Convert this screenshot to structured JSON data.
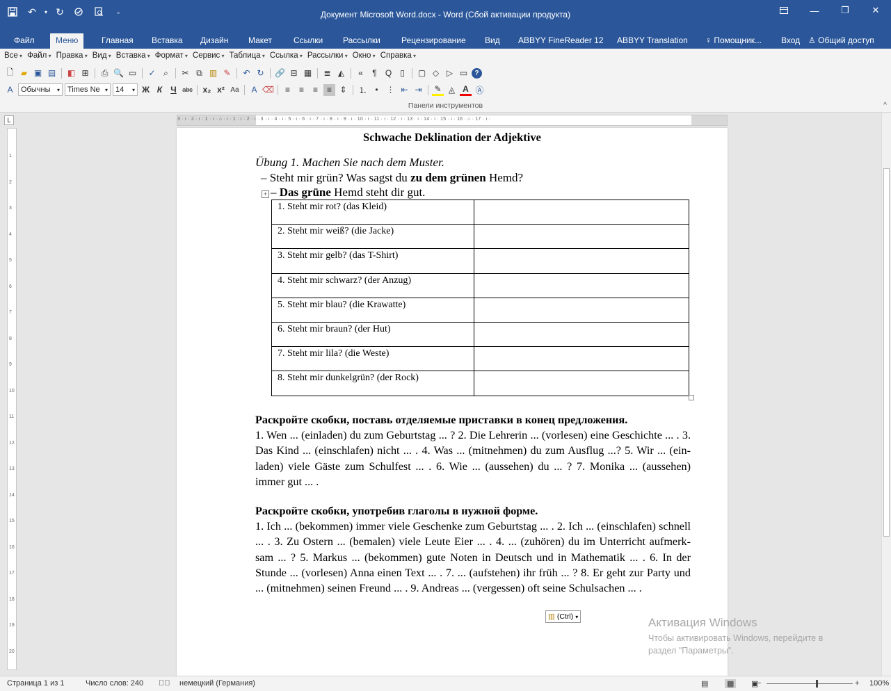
{
  "window": {
    "title": "Документ Microsoft Word.docx - Word (Сбой активации продукта)"
  },
  "qat": {
    "icons": [
      "save-icon",
      "undo-icon",
      "redo-icon",
      "spellcheck-icon",
      "print-preview-icon",
      "customize-qat-icon"
    ]
  },
  "ribbon_tabs": [
    {
      "label": "Файл"
    },
    {
      "label": "Меню",
      "active": true
    },
    {
      "label": "Главная"
    },
    {
      "label": "Вставка"
    },
    {
      "label": "Дизайн"
    },
    {
      "label": "Макет"
    },
    {
      "label": "Ссылки"
    },
    {
      "label": "Рассылки"
    },
    {
      "label": "Рецензирование"
    },
    {
      "label": "Вид"
    },
    {
      "label": "ABBYY FineReader 12"
    },
    {
      "label": "ABBYY Translation"
    },
    {
      "label": "♀ Помощник..."
    },
    {
      "label": "Вход"
    },
    {
      "label": "Общий доступ"
    }
  ],
  "menubar": [
    "Все",
    "Файл",
    "Правка",
    "Вид",
    "Вставка",
    "Формат",
    "Сервис",
    "Таблица",
    "Ссылка",
    "Рассылки",
    "Окно",
    "Справка"
  ],
  "format_bar": {
    "style": "Обычны",
    "font": "Times Ne",
    "size": "14"
  },
  "toolbars_label": "Панели инструментов",
  "document": {
    "title": "Schwache Deklination der Adjektive",
    "exercise_title": "Übung 1. Machen Sie nach dem Muster.",
    "example_q_prefix": "– Steht mir grün? Was sagst du ",
    "example_q_bold": "zu dem grünen",
    "example_q_suffix": " Hemd?",
    "example_a_prefix": "– ",
    "example_a_bold": "Das grüne",
    "example_a_suffix": " Hemd steht dir gut.",
    "table_rows": [
      "1. Steht mir rot? (das Kleid)",
      "2. Steht mir weiß? (die Jacke)",
      "3. Steht mir gelb? (das T-Shirt)",
      "4. Steht mir schwarz? (der Anzug)",
      "5. Steht mir blau? (die Krawatte)",
      "6. Steht mir braun? (der Hut)",
      "7. Steht mir lila? (die Weste)",
      "8. Steht mir dunkelgrün? (der Rock)"
    ],
    "section2_heading": "Раскройте скобки, поставь отделяемые приставки в конец предложения.",
    "section2_text": "1. Wen ... (einladen) du zum Geburtstag ... ? 2. Die Lehrerin ... (vorlesen) eine Geschichte ... . 3. Das Kind ... (einschlafen) nicht ... . 4. Was ... (mitnehmen) du zum Ausflug ...? 5. Wir ... (ein- laden) viele Gäste zum Schulfest ... . 6. Wie ... (aussehen) du ... ?  7. Monika ... (aussehen) immer gut ... .",
    "section3_heading": "Раскройте скобки, употребив глаголы в нужной форме.",
    "section3_text": "1. Ich ... (bekommen) immer viele Geschenke zum Geburtstag ... . 2. Ich ... (einschlafen) schnell ... . 3. Zu Ostern ... (bemalen) viele Leute Eier ... . 4. ... (zuhören) du im Unterricht aufmerk- sam ... ? 5. Markus ... (bekommen) gute Noten in Deutsch und in Mathematik ... . 6. In der Stunde ... (vorlesen) Anna einen Text ... . 7. ... (aufstehen) ihr früh ... ? 8. Er geht zur Party und ... (mitnehmen) seinen Freund ... . 9. Andreas ... (vergessen) oft seine Schulsachen ... ."
  },
  "paste_options": "(Ctrl)",
  "activation": {
    "line1": "Активация Windows",
    "line2": "Чтобы активировать Windows, перейдите в",
    "line3": "раздел \"Параметры\"."
  },
  "statusbar": {
    "page": "Страница 1 из 1",
    "words": "Число слов: 240",
    "language": "немецкий (Германия)",
    "zoom": "100%",
    "zoom_fraction": 0.57
  }
}
